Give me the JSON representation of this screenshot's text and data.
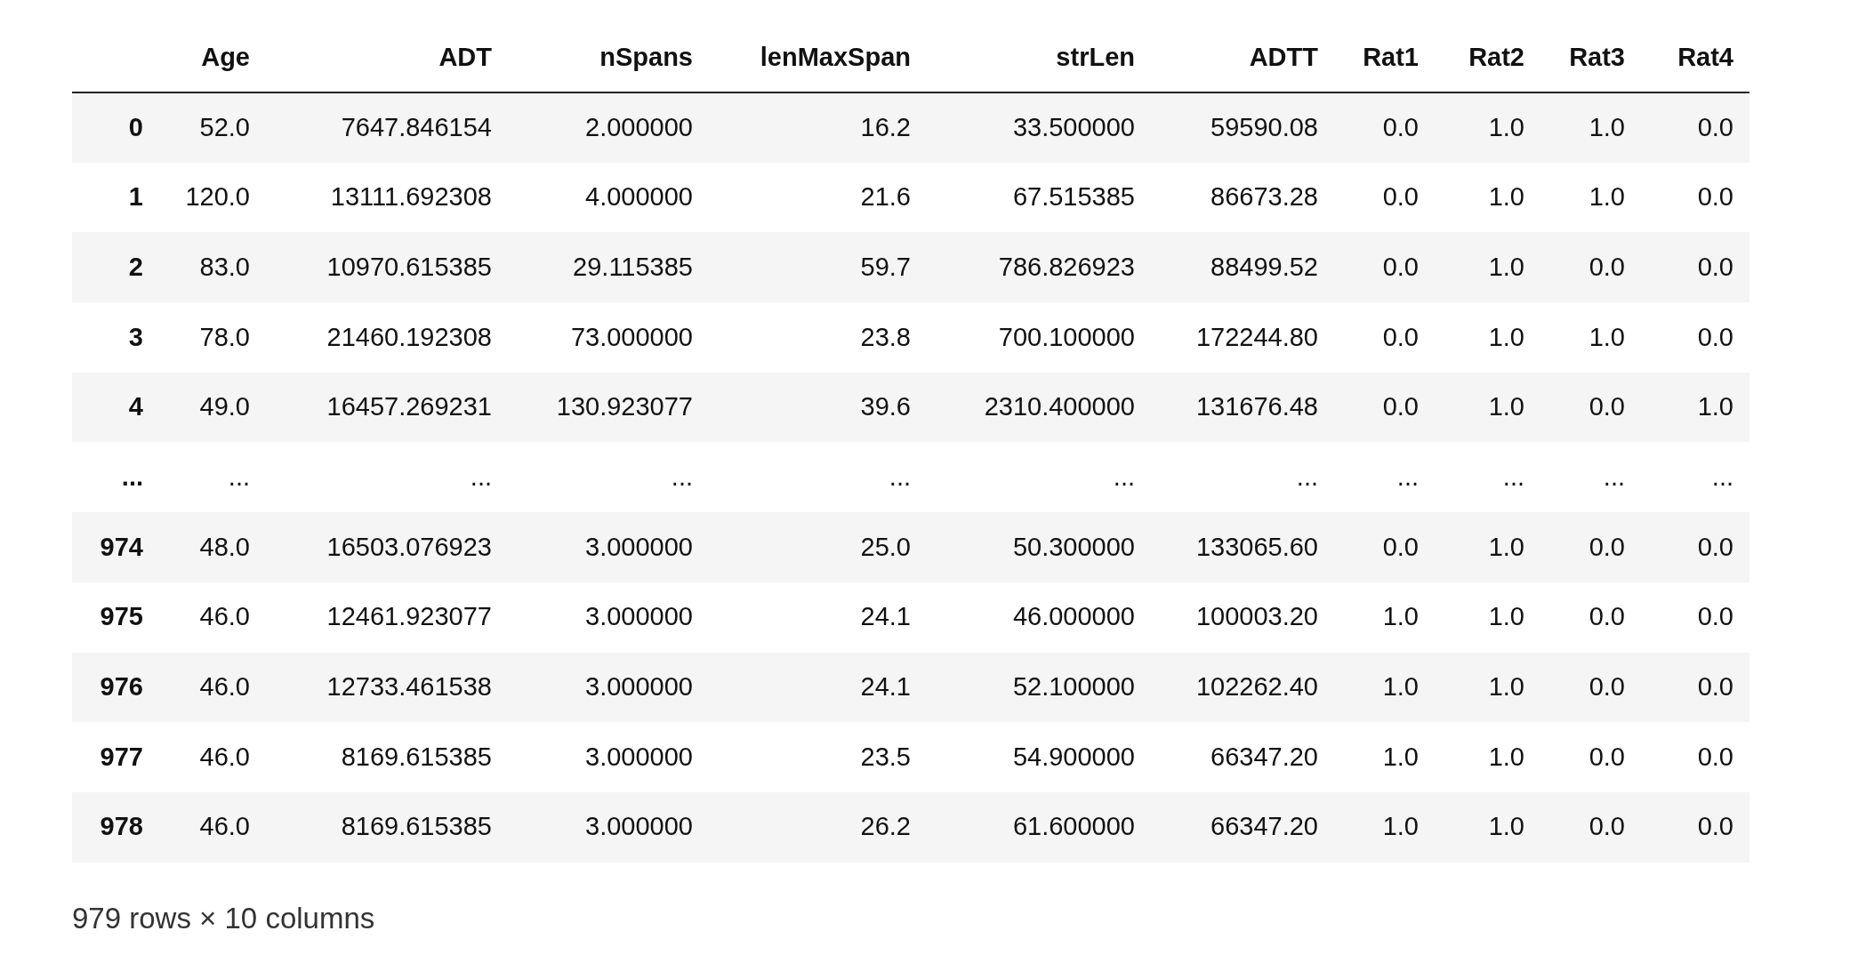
{
  "table": {
    "columns": [
      "Age",
      "ADT",
      "nSpans",
      "lenMaxSpan",
      "strLen",
      "ADTT",
      "Rat1",
      "Rat2",
      "Rat3",
      "Rat4"
    ],
    "rows": [
      {
        "index": "0",
        "cells": [
          "52.0",
          "7647.846154",
          "2.000000",
          "16.2",
          "33.500000",
          "59590.08",
          "0.0",
          "1.0",
          "1.0",
          "0.0"
        ]
      },
      {
        "index": "1",
        "cells": [
          "120.0",
          "13111.692308",
          "4.000000",
          "21.6",
          "67.515385",
          "86673.28",
          "0.0",
          "1.0",
          "1.0",
          "0.0"
        ]
      },
      {
        "index": "2",
        "cells": [
          "83.0",
          "10970.615385",
          "29.115385",
          "59.7",
          "786.826923",
          "88499.52",
          "0.0",
          "1.0",
          "0.0",
          "0.0"
        ]
      },
      {
        "index": "3",
        "cells": [
          "78.0",
          "21460.192308",
          "73.000000",
          "23.8",
          "700.100000",
          "172244.80",
          "0.0",
          "1.0",
          "1.0",
          "0.0"
        ]
      },
      {
        "index": "4",
        "cells": [
          "49.0",
          "16457.269231",
          "130.923077",
          "39.6",
          "2310.400000",
          "131676.48",
          "0.0",
          "1.0",
          "0.0",
          "1.0"
        ]
      },
      {
        "index": "...",
        "cells": [
          "...",
          "...",
          "...",
          "...",
          "...",
          "...",
          "...",
          "...",
          "...",
          "..."
        ]
      },
      {
        "index": "974",
        "cells": [
          "48.0",
          "16503.076923",
          "3.000000",
          "25.0",
          "50.300000",
          "133065.60",
          "0.0",
          "1.0",
          "0.0",
          "0.0"
        ]
      },
      {
        "index": "975",
        "cells": [
          "46.0",
          "12461.923077",
          "3.000000",
          "24.1",
          "46.000000",
          "100003.20",
          "1.0",
          "1.0",
          "0.0",
          "0.0"
        ]
      },
      {
        "index": "976",
        "cells": [
          "46.0",
          "12733.461538",
          "3.000000",
          "24.1",
          "52.100000",
          "102262.40",
          "1.0",
          "1.0",
          "0.0",
          "0.0"
        ]
      },
      {
        "index": "977",
        "cells": [
          "46.0",
          "8169.615385",
          "3.000000",
          "23.5",
          "54.900000",
          "66347.20",
          "1.0",
          "1.0",
          "0.0",
          "0.0"
        ]
      },
      {
        "index": "978",
        "cells": [
          "46.0",
          "8169.615385",
          "3.000000",
          "26.2",
          "61.600000",
          "66347.20",
          "1.0",
          "1.0",
          "0.0",
          "0.0"
        ]
      }
    ]
  },
  "footer": "979 rows × 10 columns"
}
